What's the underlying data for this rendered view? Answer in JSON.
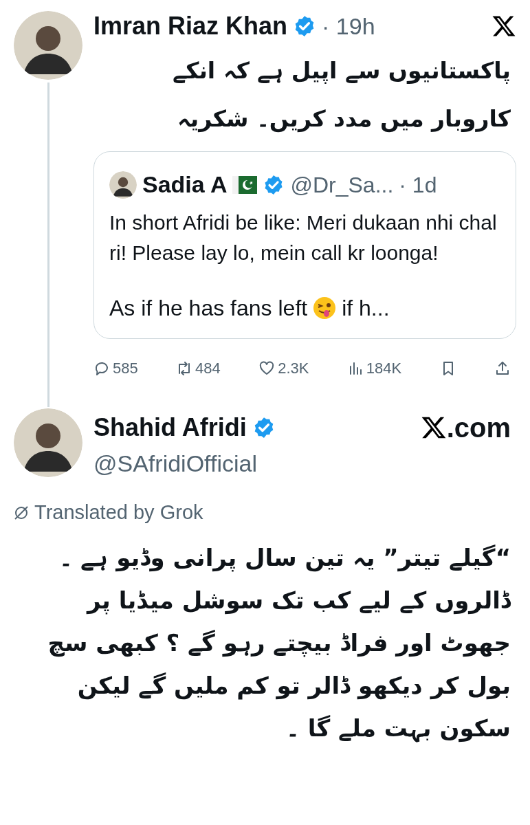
{
  "post": {
    "author": "Imran Riaz Khan",
    "verified": true,
    "time": "· 19h",
    "text": "پاکستانیوں سے اپیل ہے کہ انکے کاروبار میں مدد کریں۔ شکریہ",
    "quote": {
      "author": "Sadia A",
      "verified": true,
      "handle": "@Dr_Sa...",
      "time": "· 1d",
      "paragraphs": [
        "In short Afridi be like: Meri dukaan nhi chal ri! Please lay lo, mein call kr loonga!"
      ],
      "last_before_emoji": "As if he has fans left",
      "last_after_emoji": "if h..."
    },
    "stats": [
      {
        "kind": "reply",
        "value": "585"
      },
      {
        "kind": "repost",
        "value": "484"
      },
      {
        "kind": "like",
        "value": "2.3K"
      },
      {
        "kind": "views",
        "value": "184K"
      }
    ]
  },
  "reply": {
    "author": "Shahid Afridi",
    "verified": true,
    "handle": "@SAfridiOfficial",
    "site_suffix": ".com",
    "translation_label": "Translated by Grok",
    "text": "“گیلے تیتر” یہ تین سال پرانی وڈیو ہے ۔ ڈالروں کے لیے کب تک سوشل میڈیا پر جھوٹ اور فراڈ بیچتے رہو گے ؟ کبھی سچ بول کر دیکھو ڈالر تو کم ملیں گے لیکن سکون بہت ملے گا ۔"
  }
}
